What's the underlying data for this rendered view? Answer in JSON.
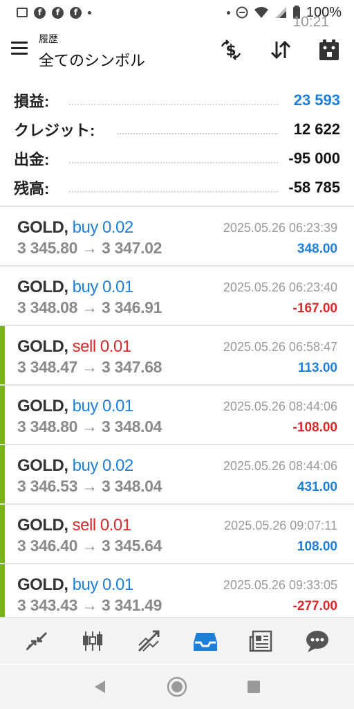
{
  "status_bar": {
    "time": "10:21",
    "battery": "100%"
  },
  "header": {
    "subtitle": "履歴",
    "title": "全てのシンボル"
  },
  "summary": [
    {
      "label": "損益:",
      "value": "23 593",
      "accent": "#1e7fd6"
    },
    {
      "label": "クレジット:",
      "value": "12 622"
    },
    {
      "label": "出金:",
      "value": "-95 000"
    },
    {
      "label": "残高:",
      "value": "-58 785"
    }
  ],
  "trades": [
    {
      "symbol": "GOLD,",
      "side": "buy 0.02",
      "prices": "3 345.80 → 3 347.02",
      "time": "2025.05.26 06:23:39",
      "profit": "348.00"
    },
    {
      "symbol": "GOLD,",
      "side": "buy 0.01",
      "prices": "3 348.08 → 3 346.91",
      "time": "2025.05.26 06:23:40",
      "profit": "-167.00"
    },
    {
      "symbol": "GOLD,",
      "side": "sell 0.01",
      "prices": "3 348.47 → 3 347.68",
      "time": "2025.05.26 06:58:47",
      "profit": "113.00"
    },
    {
      "symbol": "GOLD,",
      "side": "buy 0.01",
      "prices": "3 348.80 → 3 348.04",
      "time": "2025.05.26 08:44:06",
      "profit": "-108.00"
    },
    {
      "symbol": "GOLD,",
      "side": "buy 0.02",
      "prices": "3 346.53 → 3 348.04",
      "time": "2025.05.26 08:44:06",
      "profit": "431.00"
    },
    {
      "symbol": "GOLD,",
      "side": "sell 0.01",
      "prices": "3 346.40 → 3 345.64",
      "time": "2025.05.26 09:07:11",
      "profit": "108.00"
    },
    {
      "symbol": "GOLD,",
      "side": "buy 0.01",
      "prices": "3 343.43 → 3 341.49",
      "time": "2025.05.26 09:33:05",
      "profit": "-277.00"
    }
  ],
  "colors": {
    "buy": "#1e7fd6",
    "sell": "#d62a2a",
    "marker": "#7ab317",
    "nav_active": "#1e7fd6"
  },
  "icons": {
    "header": [
      "dollar-exchange-icon",
      "sort-icon",
      "calendar-icon"
    ],
    "bottom_nav": [
      "trade-icon",
      "chart-icon",
      "trend-icon",
      "history-icon",
      "news-icon",
      "chat-icon"
    ]
  }
}
